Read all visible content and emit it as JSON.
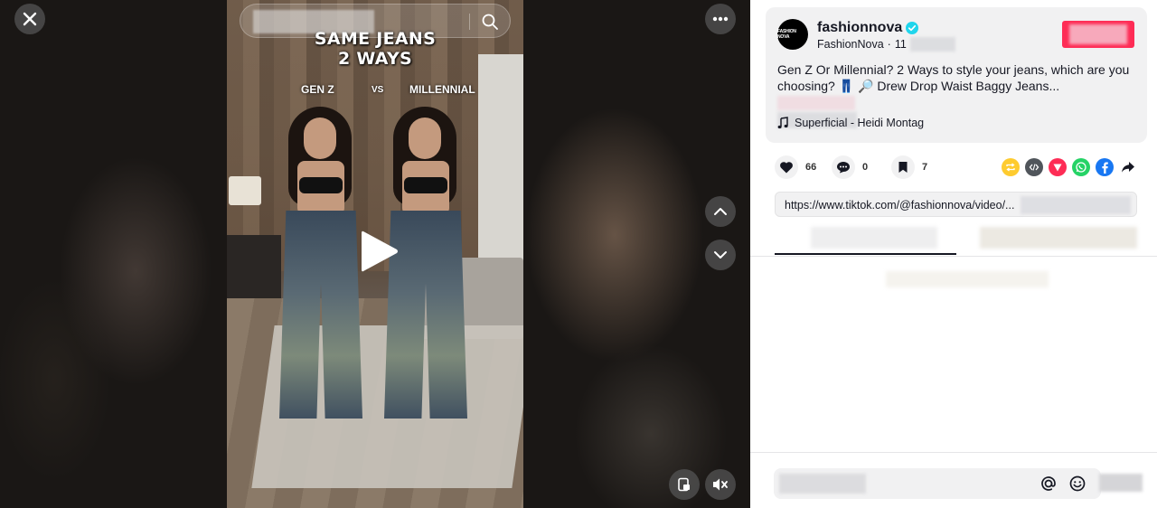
{
  "video": {
    "overlay_title_line1": "SAME JEANS",
    "overlay_title_line2": "2 WAYS",
    "label_left": "GEN Z",
    "label_mid": "VS",
    "label_right": "MILLENNIAL"
  },
  "post": {
    "avatar_text": "FASHION NOVA",
    "username": "fashionnova",
    "display_name": "FashionNova",
    "date_prefix": "11",
    "description": "Gen Z Or Millennial? 2 Ways to style your jeans, which are you choosing? 👖 🔎 Drew Drop Waist Baggy Jeans...",
    "music": "Superficial - Heidi Montag"
  },
  "actions": {
    "likes": "66",
    "comments": "0",
    "saves": "7"
  },
  "share": {
    "link": "https://www.tiktok.com/@fashionnova/video/..."
  },
  "colors": {
    "accent_red": "#fe2c55",
    "verified_blue": "#20d5ec",
    "whatsapp": "#25d366",
    "facebook": "#1877f2"
  },
  "icons": [
    "close-icon",
    "search-icon",
    "more-icon",
    "chevron-up-icon",
    "chevron-down-icon",
    "play-icon",
    "floating-player-icon",
    "mute-icon",
    "verified-icon",
    "music-note-icon",
    "heart-icon",
    "comment-icon",
    "bookmark-icon",
    "repost-icon",
    "embed-icon",
    "send-icon",
    "whatsapp-icon",
    "facebook-icon",
    "share-arrow-icon",
    "mention-icon",
    "emoji-icon"
  ]
}
